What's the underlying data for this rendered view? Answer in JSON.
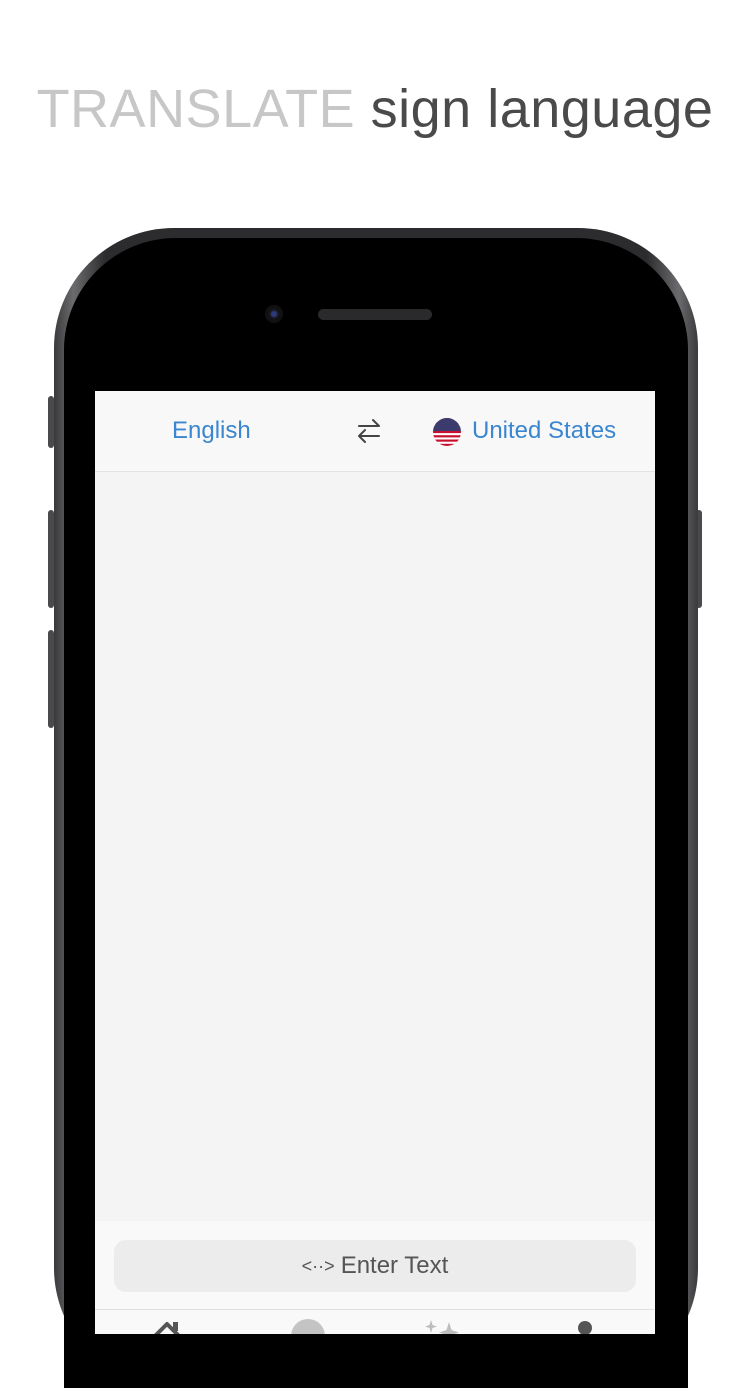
{
  "headline": {
    "light": "TRANSLATE",
    "dark": "sign language"
  },
  "language_bar": {
    "source_language": "English",
    "swap_icon": "swap-arrows-icon",
    "target_flag_icon": "us-flag-icon",
    "target_language": "United States"
  },
  "input": {
    "label": "Enter Text",
    "icon": "<··>"
  },
  "tab_bar": {
    "tabs": [
      {
        "icon": "home-icon"
      },
      {
        "icon": "circle-icon"
      },
      {
        "icon": "sparkles-icon"
      },
      {
        "icon": "person-icon"
      }
    ]
  },
  "colors": {
    "accent": "#3a86d0",
    "headline_light": "#c7c7c7",
    "headline_dark": "#4a4a4a",
    "screen_bg": "#f4f4f4"
  }
}
